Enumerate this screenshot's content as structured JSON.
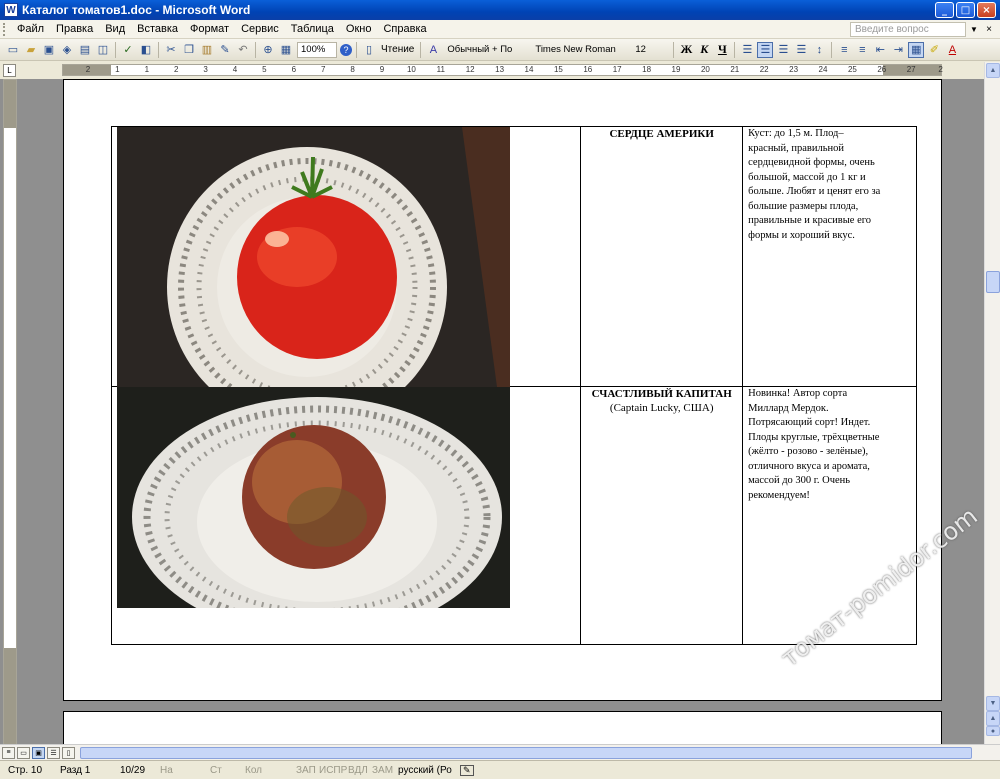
{
  "window": {
    "title": "Каталог томатов1.doc - Microsoft Word",
    "app_icon": "W",
    "minimize": "_",
    "maximize": "□",
    "close": "×"
  },
  "menu": {
    "items": [
      "Файл",
      "Правка",
      "Вид",
      "Вставка",
      "Формат",
      "Сервис",
      "Таблица",
      "Окно",
      "Справка"
    ],
    "help_placeholder": "Введите вопрос"
  },
  "toolbar": {
    "zoom": "100%",
    "reading": "Чтение",
    "style": "Обычный + По",
    "font": "Times New Roman",
    "size": "12",
    "bold": "Ж",
    "italic": "К",
    "underline": "Ч"
  },
  "ruler": {
    "numbers": [
      "2",
      "1",
      "1",
      "2",
      "3",
      "4",
      "5",
      "6",
      "7",
      "8",
      "9",
      "10",
      "11",
      "12",
      "13",
      "14",
      "15",
      "16",
      "17",
      "18",
      "19",
      "20",
      "21",
      "22",
      "23",
      "24",
      "25",
      "26",
      "27",
      "2"
    ]
  },
  "document": {
    "rows": [
      {
        "name_title": "СЕРДЦЕ АМЕРИКИ",
        "name_sub": "",
        "description_lines": [
          "Куст: до 1,5 м. Плод–",
          "красный, правильной",
          "сердцевидной формы, очень",
          "большой, массой до 1 кг и",
          "больше. Любят и ценят его за",
          "большие размеры плода,",
          "правильные и красивые его",
          "формы и хороший вкус."
        ]
      },
      {
        "name_title": "СЧАСТЛИВЫЙ КАПИТАН",
        "name_sub": "(Captain Lucky, США)",
        "description_lines": [
          "Новинка! Автор сорта",
          "Миллард Мердок.",
          "Потрясающий сорт! Индет.",
          "Плоды круглые, трёхцветные",
          "(жёлто - розово - зелёные),",
          "отличного вкуса и аромата,",
          "массой до 300 г. Очень",
          "рекомендуем!"
        ]
      }
    ]
  },
  "watermark": "томат-pomidor.com",
  "statusbar": {
    "page": "Стр. 10",
    "section": "Разд 1",
    "pages": "10/29",
    "at": "На",
    "line": "Ст",
    "col": "Кол",
    "rec": "ЗАП",
    "trk": "ИСПР",
    "ext": "ВДЛ",
    "ovr": "ЗАМ",
    "language": "русский (Ро"
  }
}
